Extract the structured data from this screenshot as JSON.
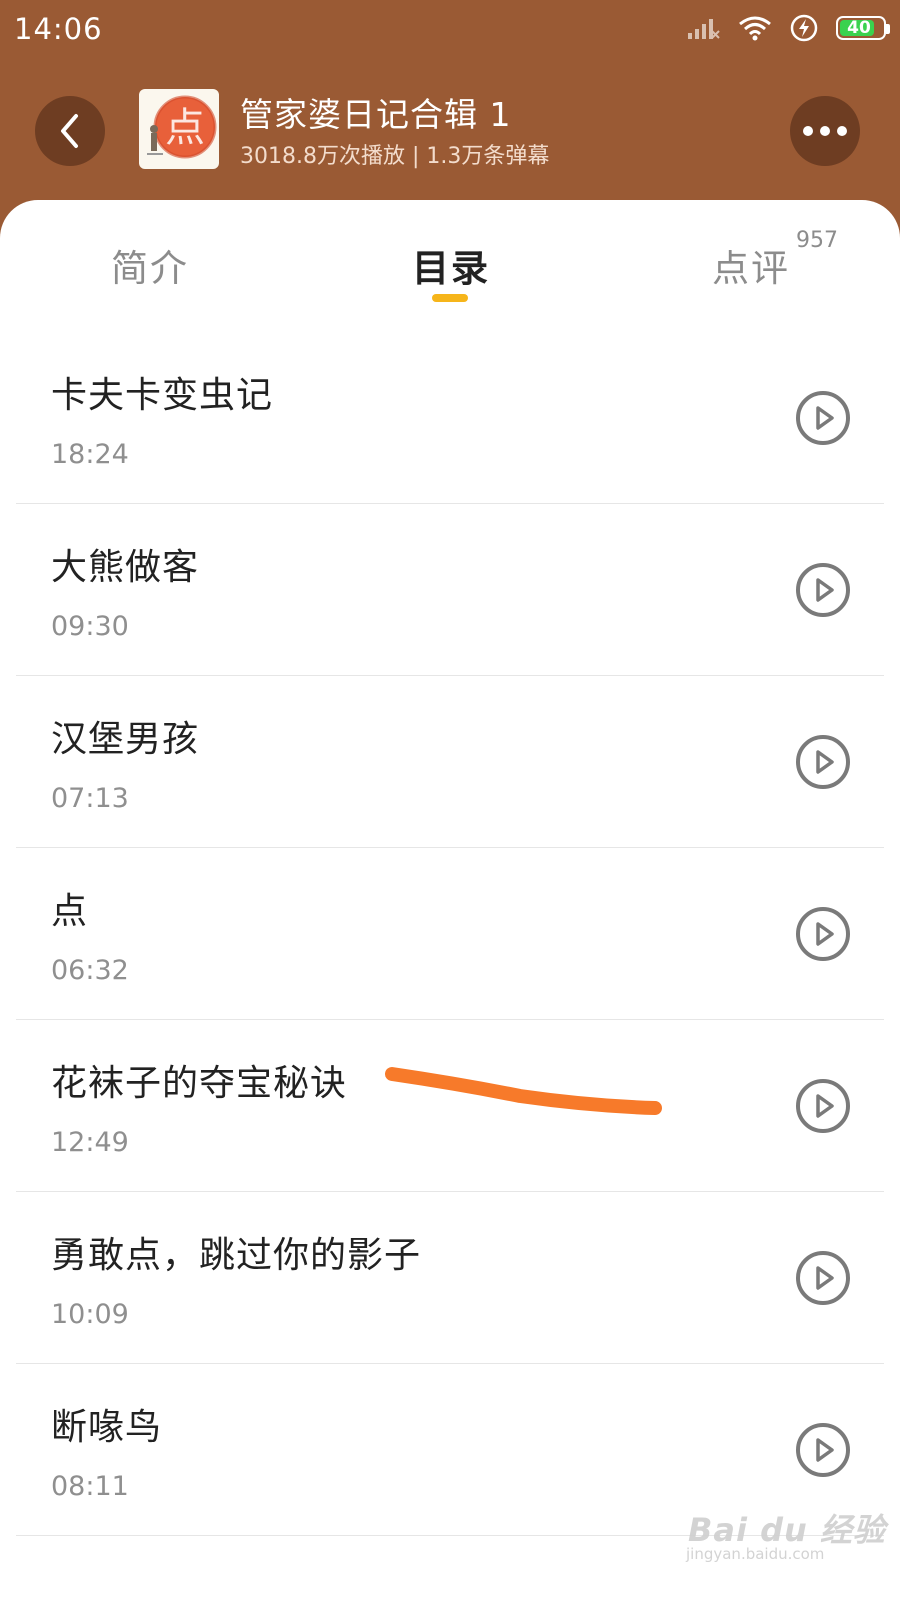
{
  "status_bar": {
    "time": "14:06",
    "battery": "40",
    "icons": [
      "signal-icon",
      "wifi-icon",
      "charging-icon",
      "battery-icon"
    ]
  },
  "header": {
    "album_title": "管家婆日记合辑 1",
    "album_stats": "3018.8万次播放 | 1.3万条弹幕",
    "cover_glyph": "点",
    "back_icon": "chevron-left-icon",
    "more_icon": "more-dots-icon"
  },
  "tabs": [
    {
      "label": "简介"
    },
    {
      "label": "目录",
      "active": true
    },
    {
      "label": "点评",
      "count": "957"
    }
  ],
  "episodes": [
    {
      "title": "卡夫卡变虫记",
      "duration": "18:24"
    },
    {
      "title": "大熊做客",
      "duration": "09:30"
    },
    {
      "title": "汉堡男孩",
      "duration": "07:13"
    },
    {
      "title": "点",
      "duration": "06:32"
    },
    {
      "title": "花袜子的夺宝秘诀",
      "duration": "12:49"
    },
    {
      "title": "勇敢点，跳过你的影子",
      "duration": "10:09"
    },
    {
      "title": "断喙鸟",
      "duration": "08:11"
    }
  ],
  "watermark": {
    "logo": "Bai du 经验",
    "url": "jingyan.baidu.com"
  },
  "colors": {
    "header_bg": "#9a5a34",
    "button_bg": "#6e3d22",
    "tab_indicator": "#f6b51a",
    "annotation_stroke": "#f77a2a"
  }
}
